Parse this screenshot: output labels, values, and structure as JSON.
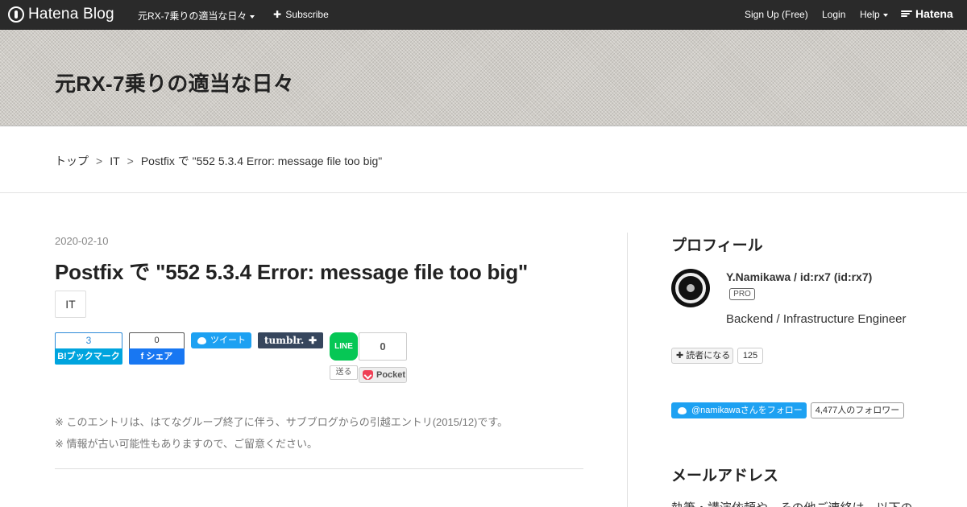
{
  "globalbar": {
    "logo_text": "Hatena Blog",
    "blog_name": "元RX-7乗りの適当な日々",
    "subscribe": "Subscribe",
    "signup": "Sign Up (Free)",
    "login": "Login",
    "help": "Help",
    "hatena": "Hatena"
  },
  "blog": {
    "title": "元RX-7乗りの適当な日々"
  },
  "breadcrumb": {
    "items": [
      "トップ",
      "IT",
      "Postfix で \"552 5.3.4 Error: message file too big\""
    ],
    "separator": ">"
  },
  "entry": {
    "date": "2020-02-10",
    "title": "Postfix で \"552 5.3.4 Error: message file too big\"",
    "category": "IT",
    "notes": [
      "※ このエントリは、はてなグループ終了に伴う、サブブログからの引越エントリ(2015/12)です。",
      "※ 情報が古い可能性もありますので、ご留意ください。"
    ]
  },
  "share": {
    "hatena_bookmark_count": "3",
    "hatena_bookmark_label": "B!ブックマーク",
    "facebook_count": "0",
    "facebook_label": "f シェア",
    "twitter_label": "ツイート",
    "tumblr_label": "tumblr.",
    "tumblr_plus": "✚",
    "line_label": "LINE",
    "line_send": "送る",
    "pocket_count": "0",
    "pocket_label": "Pocket"
  },
  "sidebar": {
    "profile_heading": "プロフィール",
    "profile_name": "Y.Namikawa / id:rx7 (id:rx7)",
    "pro_badge": "PRO",
    "profile_desc": "Backend / Infrastructure Engineer",
    "subscribe_label": "読者になる",
    "subscribe_count": "125",
    "twitter_follow_label": "@namikawaさんをフォロー",
    "twitter_follower_count": "4,477人のフォロワー",
    "mail_heading": "メールアドレス",
    "mail_text": "執筆・講演依頼や、その他ご連絡は、以下の"
  },
  "colors": {
    "header_bg": "#2a2a2a",
    "hatena_bookmark": "#00a4de",
    "facebook": "#1877f2",
    "twitter": "#1da1f2",
    "tumblr": "#36465d",
    "line": "#06c755",
    "pocket": "#ef4056"
  },
  "icons": {
    "logo": "hatena-blog-logo-icon",
    "subscribe": "plus-icon",
    "hatena": "hatena-wing-icon",
    "avatar": "steering-wheel-avatar"
  }
}
